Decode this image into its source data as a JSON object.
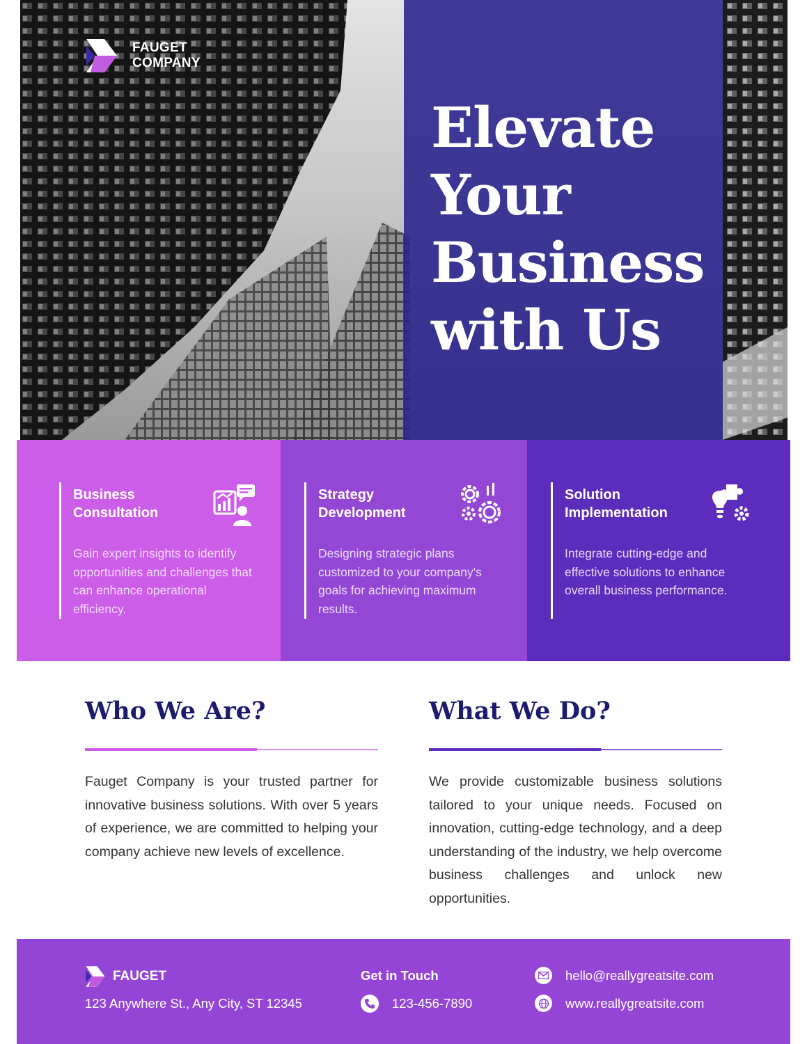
{
  "brand": {
    "name_line1": "FAUGET",
    "name_line2": "COMPANY",
    "footer_name": "FAUGET"
  },
  "hero": {
    "headline": "Elevate Your Business with Us"
  },
  "services": [
    {
      "title": "Business Consultation",
      "text": "Gain expert insights to identify opportunities and challenges that can enhance operational efficiency.",
      "icon": "consultation-icon",
      "color": "#cc5de8"
    },
    {
      "title": "Strategy Development",
      "text": "Designing strategic plans customized to your company's goals for achieving maximum results.",
      "icon": "gears-icon",
      "color": "#9447d4"
    },
    {
      "title": "Solution Implementation",
      "text": "Integrate cutting-edge and effective solutions to enhance overall business performance.",
      "icon": "puzzle-bulb-icon",
      "color": "#5c2dbd"
    }
  ],
  "about": {
    "title": "Who We Are?",
    "text": "Fauget Company is your trusted partner for innovative business solutions. With over 5 years of experience, we are committed to helping your company achieve new levels of excellence."
  },
  "work": {
    "title": "What We Do?",
    "text": "We provide customizable business solutions tailored to your unique needs. Focused on innovation, cutting-edge technology, and a deep understanding of the industry, we help overcome business challenges and unlock new opportunities."
  },
  "footer": {
    "address": "123 Anywhere St., Any City, ST 12345",
    "contact_heading": "Get in Touch",
    "phone": "123-456-7890",
    "email": "hello@reallygreatsite.com",
    "website": "www.reallygreatsite.com"
  },
  "colors": {
    "navy": "#1c1c6e",
    "pink": "#cc5de8",
    "violet": "#9447d4",
    "indigo": "#5c2dbd",
    "overlay": "#28218c"
  }
}
